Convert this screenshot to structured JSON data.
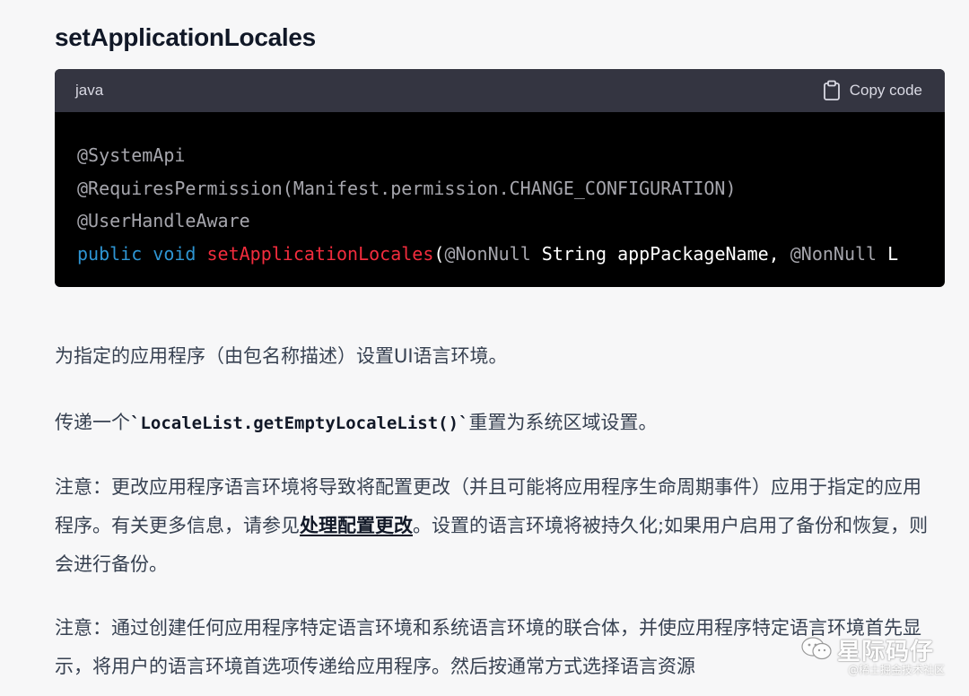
{
  "heading": "setApplicationLocales",
  "code_block": {
    "language": "java",
    "copy_label": "Copy code",
    "lines": [
      [
        {
          "t": "anno",
          "s": "@SystemApi"
        }
      ],
      [
        {
          "t": "anno",
          "s": "@RequiresPermission(Manifest.permission.CHANGE_CONFIGURATION)"
        }
      ],
      [
        {
          "t": "anno",
          "s": "@UserHandleAware"
        }
      ],
      [
        {
          "t": "kw",
          "s": "public"
        },
        {
          "t": "plain",
          "s": " "
        },
        {
          "t": "kw",
          "s": "void"
        },
        {
          "t": "plain",
          "s": " "
        },
        {
          "t": "fn",
          "s": "setApplicationLocales"
        },
        {
          "t": "plain",
          "s": "("
        },
        {
          "t": "anno",
          "s": "@NonNull"
        },
        {
          "t": "plain",
          "s": " String appPackageName, "
        },
        {
          "t": "anno",
          "s": "@NonNull"
        },
        {
          "t": "plain",
          "s": " L"
        }
      ]
    ]
  },
  "paragraphs": {
    "p1": "为指定的应用程序（由包名称描述）设置UI语言环境。",
    "p2_before": "传递一个",
    "p2_code": "`LocaleList.getEmptyLocaleList()`",
    "p2_after": "重置为系统区域设置。",
    "p3_before": "注意：更改应用程序语言环境将导致将配置更改（并且可能将应用程序生命周期事件）应用于指定的应用程序。有关更多信息，请参见",
    "p3_link": "处理配置更改",
    "p3_after": "。设置的语言环境将被持久化;如果用户启用了备份和恢复，则会进行备份。",
    "p4": "注意：通过创建任何应用程序特定语言环境和系统语言环境的联合体，并使应用程序特定语言环境首先显示，将用户的语言环境首选项传递给应用程序。然后按通常方式选择语言资源"
  },
  "watermark": {
    "icon": "wechat-icon",
    "name": "星际码仔",
    "sub": "@稀土掘金技术社区"
  },
  "colors": {
    "code_bg": "#000000",
    "code_header_bg": "#343541",
    "keyword": "#2e95d3",
    "function": "#f22c3d",
    "annotation": "#a6a6ad",
    "page_bg": "#f7f7f8"
  }
}
